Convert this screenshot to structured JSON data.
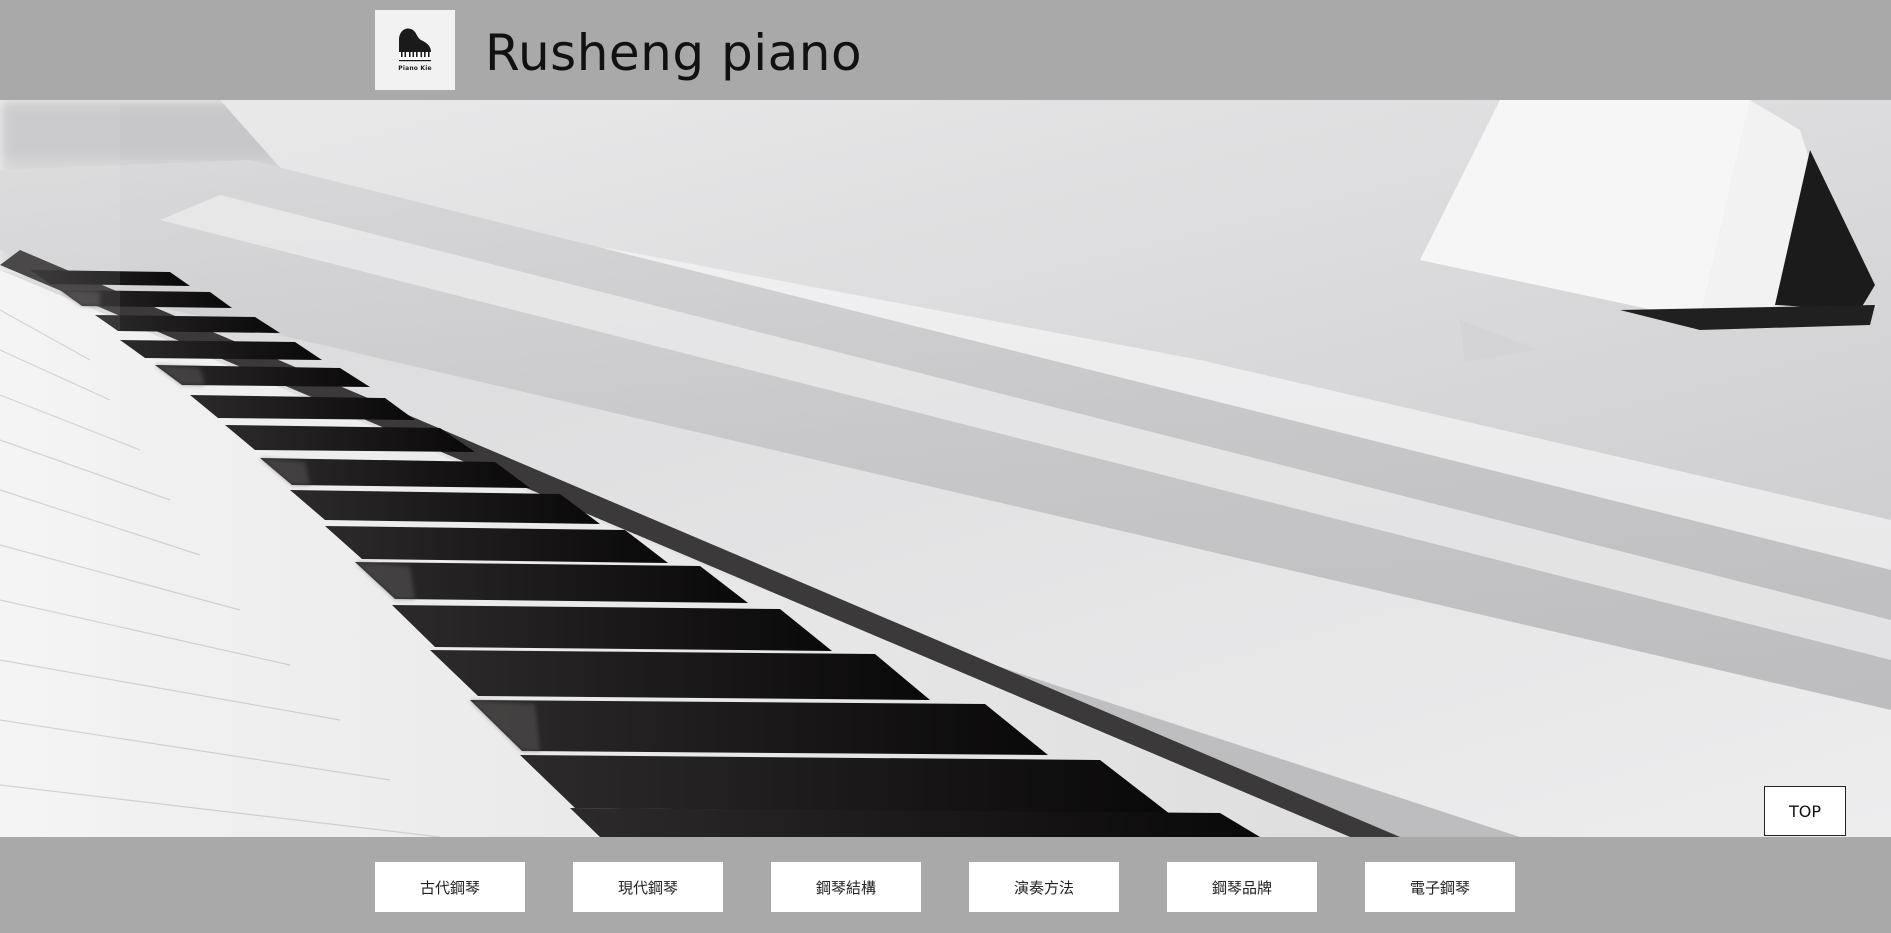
{
  "header": {
    "title": "Rusheng piano",
    "logo": {
      "icon": "grand-piano-logo-icon",
      "text": "Piano Kie"
    }
  },
  "hero": {
    "image": "white-piano-keyboard-photo"
  },
  "top_button": {
    "label": "TOP"
  },
  "nav": {
    "items": [
      {
        "label": "古代鋼琴"
      },
      {
        "label": "現代鋼琴"
      },
      {
        "label": "鋼琴結構"
      },
      {
        "label": "演奏方法"
      },
      {
        "label": "鋼琴品牌"
      },
      {
        "label": "電子鋼琴"
      }
    ]
  },
  "colors": {
    "bar_background": "#a9a9a9",
    "button_background": "#ffffff",
    "title_color": "#111111"
  }
}
